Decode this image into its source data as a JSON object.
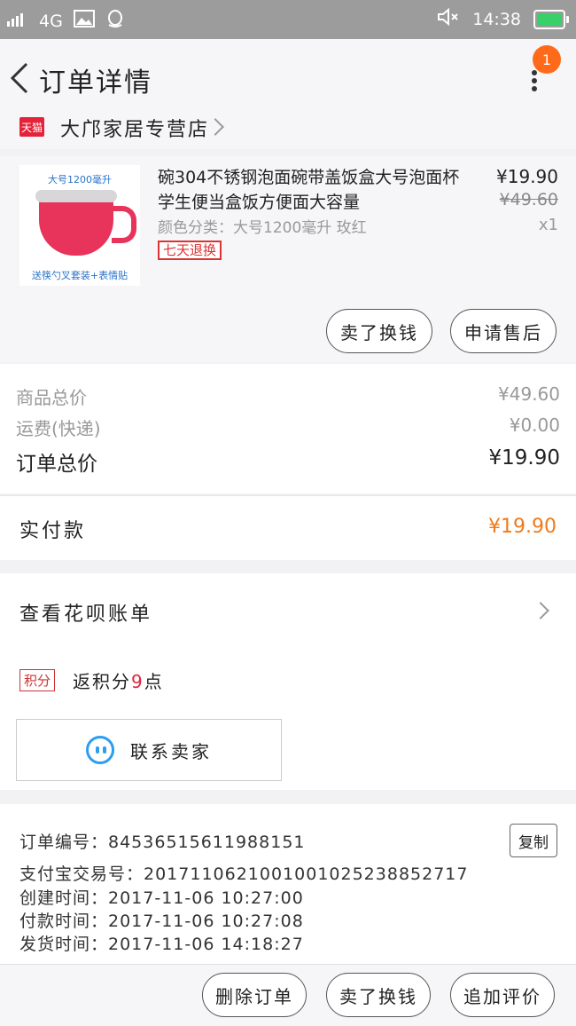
{
  "status_bar": {
    "network": "4G",
    "time": "14:38"
  },
  "header": {
    "title": "订单详情",
    "badge_count": "1"
  },
  "store": {
    "platform_badge": "天猫",
    "name": "大邝家居专营店"
  },
  "product": {
    "image_caption_top": "大号1200毫升",
    "image_caption_bottom": "送筷勺叉套装+表情贴",
    "title": "碗304不锈钢泡面碗带盖饭盒大号泡面杯学生便当盒饭方便面大容量",
    "spec": "颜色分类：大号1200毫升 玫红",
    "tag": "七天退换",
    "price": "¥19.90",
    "original_price": "¥49.60",
    "quantity": "x1",
    "buttons": [
      "卖了换钱",
      "申请售后"
    ]
  },
  "totals": {
    "goods_label": "商品总价",
    "goods_value": "¥49.60",
    "shipping_label": "运费(快递)",
    "shipping_value": "¥0.00",
    "order_label": "订单总价",
    "order_value": "¥19.90",
    "paid_label": "实付款",
    "paid_value": "¥19.90"
  },
  "huabei": {
    "label": "查看花呗账单"
  },
  "points": {
    "badge": "积分",
    "text_prefix": "返积分",
    "points": "9",
    "text_suffix": "点"
  },
  "contact": {
    "label": "联系卖家"
  },
  "order_info": {
    "order_no": "订单编号：84536515611988151",
    "alipay_no": "支付宝交易号：2017110621001001025238852717",
    "created": "创建时间：2017-11-06 10:27:00",
    "paid": "付款时间：2017-11-06 10:27:08",
    "shipped": "发货时间：2017-11-06 14:18:27",
    "copy_label": "复制"
  },
  "bottom_bar": {
    "delete": "删除订单",
    "sell": "卖了换钱",
    "review": "追加评价"
  },
  "colors": {
    "accent_orange": "#ff6a1a",
    "price_orange": "#f07a1a",
    "tmall_red": "#e4233a",
    "contact_blue": "#2b9ef0"
  }
}
